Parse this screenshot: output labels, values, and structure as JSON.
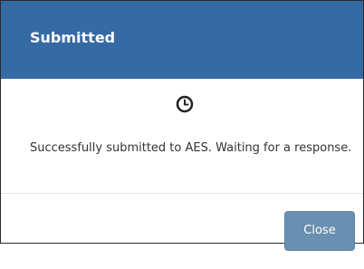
{
  "dialog": {
    "title": "Submitted",
    "status_icon": "clock-icon",
    "message": "Successfully submitted to AES. Waiting for a response.",
    "close_label": "Close"
  },
  "colors": {
    "header": "#356aa5",
    "button": "#6a8fb0",
    "text": "#333333"
  }
}
